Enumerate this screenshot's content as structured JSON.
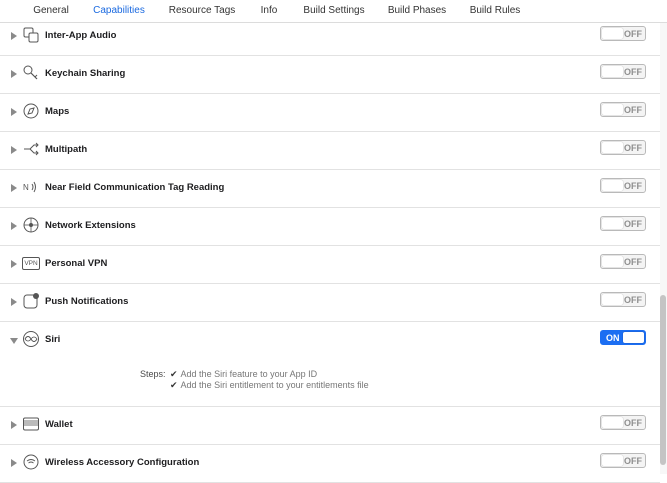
{
  "tabs": [
    {
      "label": "General",
      "active": false
    },
    {
      "label": "Capabilities",
      "active": true
    },
    {
      "label": "Resource Tags",
      "active": false
    },
    {
      "label": "Info",
      "active": false
    },
    {
      "label": "Build Settings",
      "active": false
    },
    {
      "label": "Build Phases",
      "active": false
    },
    {
      "label": "Build Rules",
      "active": false
    }
  ],
  "capabilities": [
    {
      "label": "Inter-App Audio",
      "icon": "inter-app-audio-icon",
      "state": "OFF"
    },
    {
      "label": "Keychain Sharing",
      "icon": "key-icon",
      "state": "OFF"
    },
    {
      "label": "Maps",
      "icon": "maps-compass-icon",
      "state": "OFF"
    },
    {
      "label": "Multipath",
      "icon": "multipath-arrows-icon",
      "state": "OFF"
    },
    {
      "label": "Near Field Communication Tag Reading",
      "icon": "nfc-icon",
      "state": "OFF"
    },
    {
      "label": "Network Extensions",
      "icon": "network-extensions-icon",
      "state": "OFF"
    },
    {
      "label": "Personal VPN",
      "icon": "vpn-icon",
      "vpn_text": "VPN",
      "state": "OFF"
    },
    {
      "label": "Push Notifications",
      "icon": "push-notification-icon",
      "state": "OFF"
    },
    {
      "label": "Siri",
      "icon": "siri-icon",
      "state": "ON",
      "expanded": true,
      "steps_label": "Steps:",
      "steps": [
        "Add the Siri feature to your App ID",
        "Add the Siri entitlement to your entitlements file"
      ],
      "check": "✔"
    },
    {
      "label": "Wallet",
      "icon": "wallet-icon",
      "state": "OFF"
    },
    {
      "label": "Wireless Accessory Configuration",
      "icon": "wireless-accessory-icon",
      "state": "OFF"
    }
  ],
  "colors": {
    "accent": "#1b6ae0",
    "toggle_on": "#1c6ef2"
  }
}
